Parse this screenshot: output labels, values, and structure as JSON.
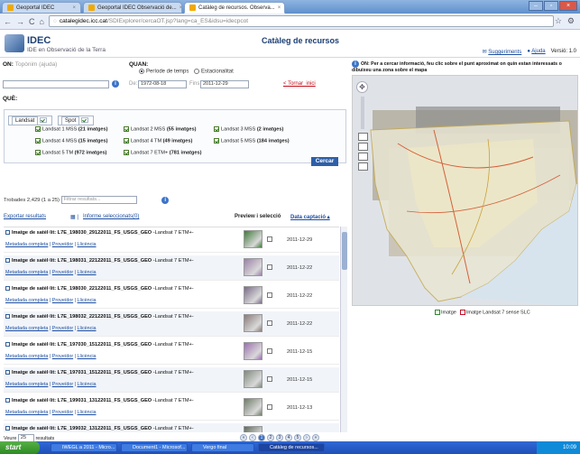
{
  "browser": {
    "tabs": [
      {
        "label": "Geoportal IDEC"
      },
      {
        "label": "Geoportal IDEC Observació de..."
      },
      {
        "label": "Catàleg de recursos. Observa..."
      }
    ],
    "url_host": "catalegidec.icc.cat",
    "url_path": "/SDIExplorer/cercaOT.jsp?lang=ca_ES&idsu=idecpcot"
  },
  "header": {
    "brand": "IDEC",
    "brand_sub": "IDE en Observació de la Terra",
    "page_title": "Catàleg de recursos",
    "suggestions": "Suggeriments",
    "help": "Ajuda",
    "version": "Versió: 1.0"
  },
  "search": {
    "on_label": "ON:",
    "on_hint": "Topònim (ajuda)",
    "when_label": "QUAN:",
    "period_label": "Període de temps",
    "seasonality_label": "Estacionalitat",
    "from_label": "De:",
    "from_value": "1972-08-18",
    "to_label": "Fins a:",
    "to_value": "2011-12-29",
    "back_link": "< Tornar_inici",
    "what_label": "QUÈ:",
    "type_tabs": [
      "Landsat",
      "Spot"
    ],
    "sensors": [
      {
        "name": "Landsat 1 MSS",
        "count": "(21 imatges)"
      },
      {
        "name": "Landsat 2 MSS",
        "count": "(55 imatges)"
      },
      {
        "name": "Landsat 3 MSS",
        "count": "(2 imatges)"
      },
      {
        "name": "Landsat 4 MSS",
        "count": "(15 imatges)"
      },
      {
        "name": "Landsat 4 TM",
        "count": "(49 imatges)"
      },
      {
        "name": "Landsat 5 MSS",
        "count": "(184 imatges)"
      },
      {
        "name": "Landsat 5 TM",
        "count": "(972 imatges)"
      },
      {
        "name": "Landsat 7 ETM+",
        "count": "(781 imatges)"
      }
    ],
    "search_button": "Cercar"
  },
  "results": {
    "found_text": "Trobades 2,429 (1 a 25)",
    "filter_placeholder": "Filtrar resultats...",
    "export_link": "Exportar resultats",
    "report_link": "Informe seleccionats(0)",
    "col_preview": "Preview i selecció",
    "col_date": "Data captació ▴",
    "rows": [
      {
        "title": "Imatge de satèl·lit: L7E_198030_29122011_FS_USGS_GEO",
        "sensor": "-Landsat 7 ETM+-",
        "date": "2011-12-29",
        "thumb": "#3e7a3a"
      },
      {
        "title": "Imatge de satèl·lit: L7E_198031_22122011_FS_USGS_GEO",
        "sensor": "-Landsat 7 ETM+-",
        "date": "2011-12-22",
        "thumb": "#9b7fa8"
      },
      {
        "title": "Imatge de satèl·lit: L7E_198030_22122011_FS_USGS_GEO",
        "sensor": "-Landsat 7 ETM+-",
        "date": "2011-12-22",
        "thumb": "#7a6b88"
      },
      {
        "title": "Imatge de satèl·lit: L7E_198032_22122011_FS_USGS_GEO",
        "sensor": "-Landsat 7 ETM+-",
        "date": "2011-12-22",
        "thumb": "#8a7a7a"
      },
      {
        "title": "Imatge de satèl·lit: L7E_197030_15122011_FS_USGS_GEO",
        "sensor": "-Landsat 7 ETM+-",
        "date": "2011-12-15",
        "thumb": "#9a6fb0"
      },
      {
        "title": "Imatge de satèl·lit: L7E_197031_15122011_FS_USGS_GEO",
        "sensor": "-Landsat 7 ETM+-",
        "date": "2011-12-15",
        "thumb": "#7f8a7d"
      },
      {
        "title": "Imatge de satèl·lit: L7E_199031_13122011_FS_USGS_GEO",
        "sensor": "-Landsat 7 ETM+-",
        "date": "2011-12-13",
        "thumb": "#6f7b68"
      },
      {
        "title": "Imatge de satèl·lit: L7E_199032_13122011_FS_USGS_GEO",
        "sensor": "-Landsat 7 ETM+-",
        "date": "2011-12-13",
        "thumb": "#5f6a5a"
      }
    ],
    "row_links": [
      "Metadada completa",
      "Proveïdor",
      "Llicència"
    ],
    "per_page_label": "Veure",
    "per_page_value": "25",
    "per_page_suffix": "resultats",
    "pages": [
      "«",
      "‹",
      "1",
      "2",
      "3",
      "4",
      "5",
      "›",
      "»"
    ],
    "current_page": "1"
  },
  "map": {
    "info_text": "ON: Per a cercar informació, feu clic sobre el punt aproximat on quin estan interessats o dibuixeu una zona sobre el mapa",
    "legend": [
      {
        "label": "Imatge",
        "color": "#2e8a2e"
      },
      {
        "label": "Imatge Landsat 7 sense SLC",
        "color": "#c0102a"
      }
    ]
  },
  "taskbar": {
    "start": "start",
    "tasks": [
      "IWEGL a 2011 - Micro...",
      "Document1 - Microsof...",
      "Vergo final",
      "Catàleg de recursos..."
    ],
    "clock": "10:09"
  }
}
